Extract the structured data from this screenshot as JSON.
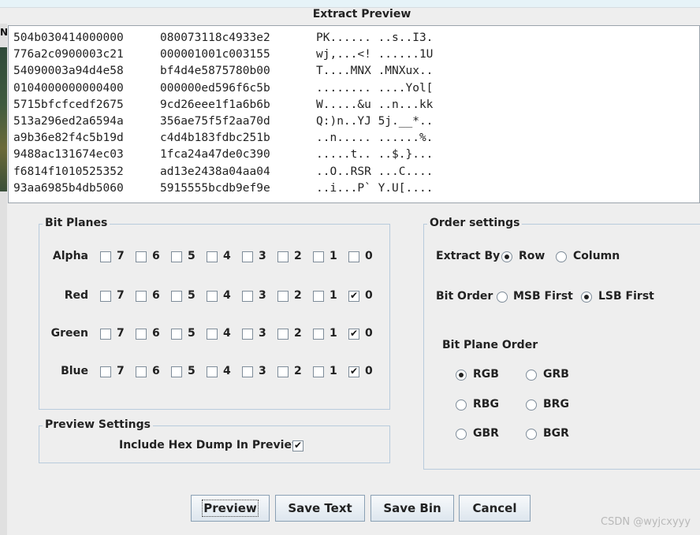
{
  "window": {
    "title": "Extract Preview",
    "corner_char": "N"
  },
  "preview": {
    "rows": [
      [
        "504b030414000000",
        "080073118c4933e2",
        "PK...... ..s..I3."
      ],
      [
        "776a2c0900003c21",
        "000001001c003155",
        "wj,...<! ......1U"
      ],
      [
        "54090003a94d4e58",
        "bf4d4e5875780b00",
        "T....MNX .MNXux.."
      ],
      [
        "0104000000000400",
        "000000ed596f6c5b",
        "........ ....Yol["
      ],
      [
        "5715bfcfcedf2675",
        "9cd26eee1f1a6b6b",
        "W.....&u ..n...kk"
      ],
      [
        "513a296ed2a6594a",
        "356ae75f5f2aa70d",
        "Q:)n..YJ 5j.__*.."
      ],
      [
        "a9b36e82f4c5b19d",
        "c4d4b183fdbc251b",
        "..n..... ......%."
      ],
      [
        "9488ac131674ec03",
        "1fca24a47de0c390",
        ".....t.. ..$.}..."
      ],
      [
        "f6814f1010525352",
        "ad13e2438a04aa04",
        "..O..RSR ...C...."
      ],
      [
        "93aa6985b4db5060",
        "5915555bcdb9ef9e",
        "..i...P` Y.U[...."
      ]
    ]
  },
  "bit_planes": {
    "title": "Bit Planes",
    "bits": [
      "7",
      "6",
      "5",
      "4",
      "3",
      "2",
      "1",
      "0"
    ],
    "channels": [
      {
        "label": "Alpha",
        "checked": [
          false,
          false,
          false,
          false,
          false,
          false,
          false,
          false
        ]
      },
      {
        "label": "Red",
        "checked": [
          false,
          false,
          false,
          false,
          false,
          false,
          false,
          true
        ]
      },
      {
        "label": "Green",
        "checked": [
          false,
          false,
          false,
          false,
          false,
          false,
          false,
          true
        ]
      },
      {
        "label": "Blue",
        "checked": [
          false,
          false,
          false,
          false,
          false,
          false,
          false,
          true
        ]
      }
    ]
  },
  "preview_settings": {
    "title": "Preview Settings",
    "hex_dump_label": "Include Hex Dump In Preview",
    "hex_dump_checked": true
  },
  "order_settings": {
    "title": "Order settings",
    "extract_by_label": "Extract By",
    "extract_by_options": [
      "Row",
      "Column"
    ],
    "extract_by_selected": "Row",
    "bit_order_label": "Bit Order",
    "bit_order_options": [
      "MSB First",
      "LSB First"
    ],
    "bit_order_selected": "LSB First",
    "plane_order_label": "Bit Plane Order",
    "plane_order_options": [
      "RGB",
      "GRB",
      "RBG",
      "BRG",
      "GBR",
      "BGR"
    ],
    "plane_order_selected": "RGB"
  },
  "buttons": {
    "preview": "Preview",
    "save_text": "Save Text",
    "save_bin": "Save Bin",
    "cancel": "Cancel"
  },
  "watermark": "CSDN @wyjcxyyy"
}
